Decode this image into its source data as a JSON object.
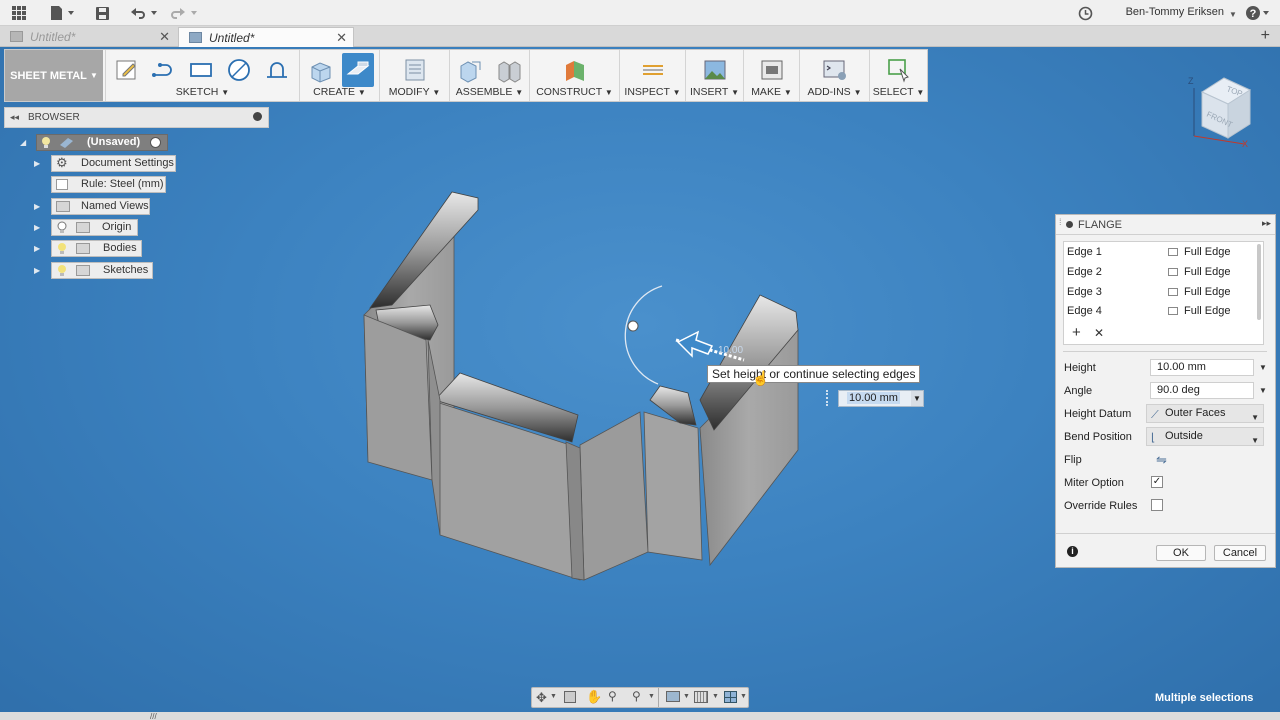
{
  "user_name": "Ben-Tommy Eriksen",
  "tabs": [
    {
      "label": "Untitled*",
      "active": false
    },
    {
      "label": "Untitled*",
      "active": true
    }
  ],
  "toolbar": {
    "workspace": "SHEET METAL",
    "groups": [
      "SKETCH",
      "CREATE",
      "MODIFY",
      "ASSEMBLE",
      "CONSTRUCT",
      "INSPECT",
      "INSERT",
      "MAKE",
      "ADD-INS",
      "SELECT"
    ]
  },
  "browser": {
    "title": "BROWSER",
    "root": "(Unsaved)",
    "items": [
      "Document Settings",
      "Rule: Steel (mm)",
      "Named Views",
      "Origin",
      "Bodies",
      "Sketches"
    ]
  },
  "viewport": {
    "tooltip": "Set height or continue selecting edges",
    "height_input": "10.00 mm",
    "ghost_value": "10.00",
    "status": "Multiple selections",
    "viewcube": {
      "top": "TOP",
      "front": "FRONT",
      "z": "Z",
      "x": "X"
    }
  },
  "flange": {
    "title": "FLANGE",
    "edges": [
      {
        "name": "Edge 1",
        "type": "Full Edge"
      },
      {
        "name": "Edge 2",
        "type": "Full Edge"
      },
      {
        "name": "Edge 3",
        "type": "Full Edge"
      },
      {
        "name": "Edge 4",
        "type": "Full Edge"
      }
    ],
    "height_label": "Height",
    "height_value": "10.00 mm",
    "angle_label": "Angle",
    "angle_value": "90.0 deg",
    "height_datum_label": "Height Datum",
    "height_datum_value": "Outer Faces",
    "bend_position_label": "Bend Position",
    "bend_position_value": "Outside",
    "flip_label": "Flip",
    "miter_label": "Miter Option",
    "miter_checked": true,
    "override_label": "Override Rules",
    "override_checked": false,
    "ok_label": "OK",
    "cancel_label": "Cancel"
  },
  "colors": {
    "accent": "#3d89c9",
    "canvas": "#3c82c0"
  }
}
